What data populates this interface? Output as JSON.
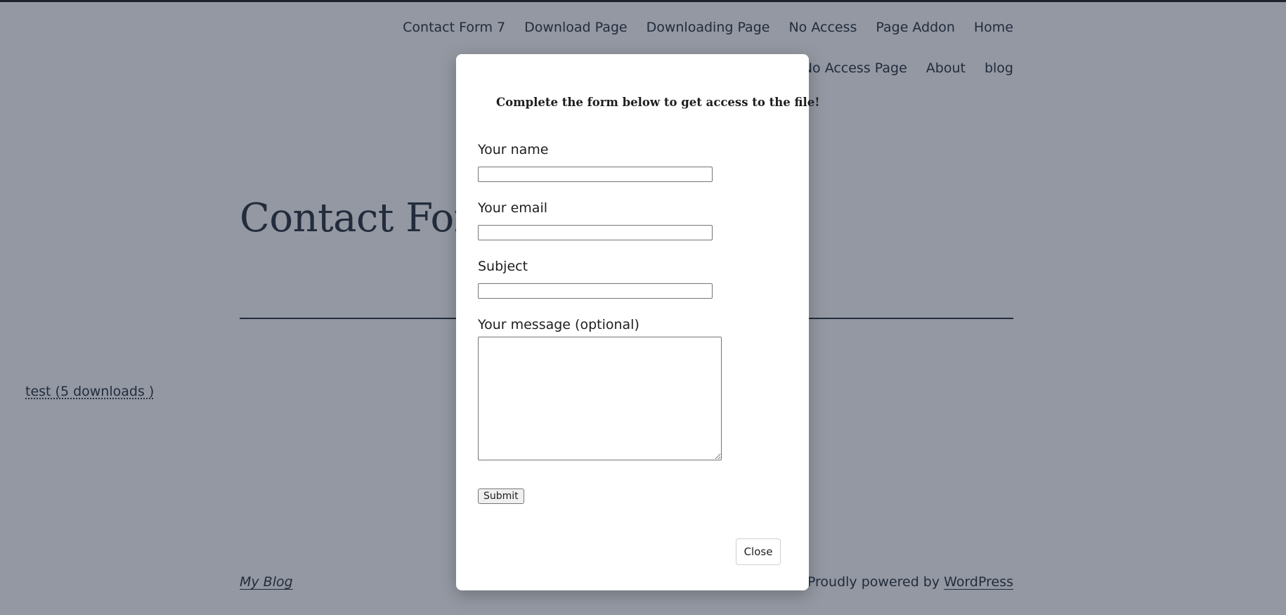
{
  "nav": {
    "row1": [
      "Contact Form 7",
      "Download Page",
      "Downloading Page",
      "No Access",
      "Page Addon",
      "Home"
    ],
    "row2": [
      "No Access Page",
      "About",
      "blog"
    ]
  },
  "page": {
    "title": "Contact Form",
    "download_link": "test (5 downloads )"
  },
  "footer": {
    "site_name": "My Blog",
    "powered_prefix": "Proudly powered by ",
    "powered_link": "WordPress"
  },
  "modal": {
    "heading": "Complete the form below to get access to the file!",
    "fields": {
      "name_label": "Your name",
      "name_value": "",
      "email_label": "Your email",
      "email_value": "",
      "subject_label": "Subject",
      "subject_value": "",
      "message_label": "Your message (optional)",
      "message_value": ""
    },
    "submit_label": "Submit",
    "close_label": "Close"
  }
}
